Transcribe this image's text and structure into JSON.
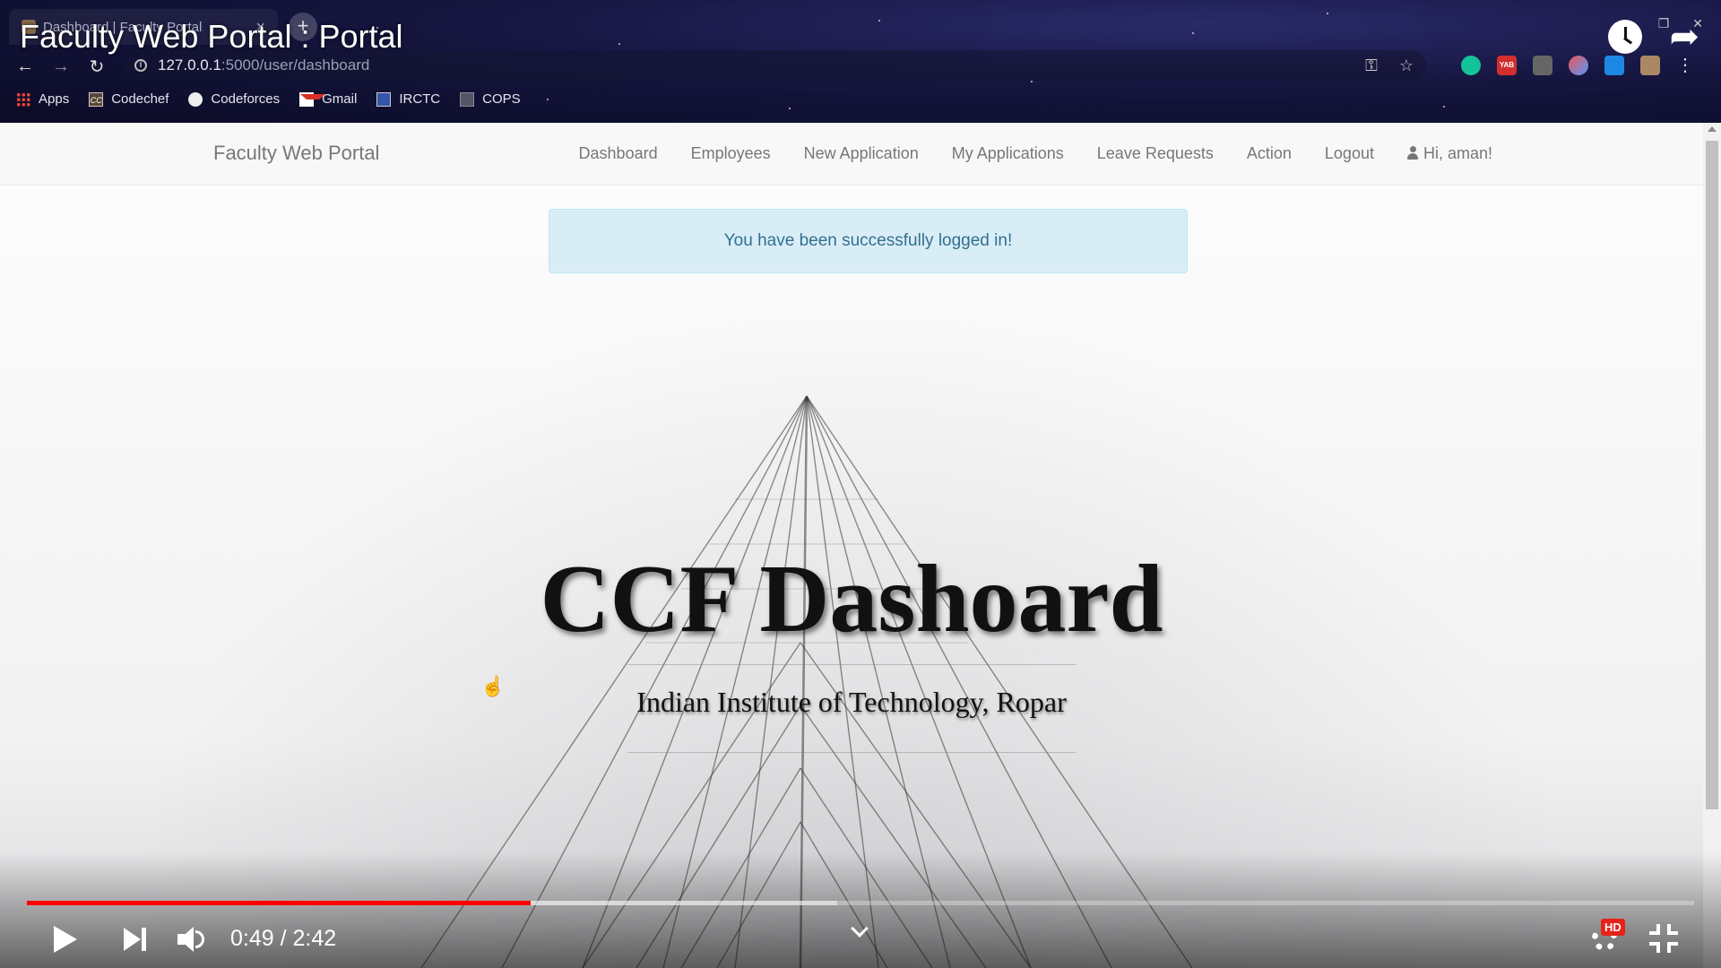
{
  "browser": {
    "tab_title": "Dashboard | Faculty Portal",
    "url_host": "127.0.0.1",
    "url_path": ":5000/user/dashboard",
    "bookmarks": [
      {
        "label": "Apps",
        "icon": "apps-grid-icon"
      },
      {
        "label": "Codechef",
        "icon": "codechef-icon"
      },
      {
        "label": "Codeforces",
        "icon": "codeforces-icon"
      },
      {
        "label": "Gmail",
        "icon": "gmail-icon"
      },
      {
        "label": "IRCTC",
        "icon": "irctc-icon"
      },
      {
        "label": "COPS",
        "icon": "cops-icon"
      }
    ]
  },
  "video": {
    "title": "Faculty Web Portal : Portal",
    "current_time": "0:49",
    "duration": "2:42",
    "time_display": "0:49 / 2:42",
    "played_fraction": 0.302,
    "buffered_fraction": 0.486,
    "quality_badge": "HD",
    "accent_color": "#ff0000"
  },
  "navbar": {
    "brand": "Faculty Web Portal",
    "links": [
      {
        "label": "Dashboard"
      },
      {
        "label": "Employees"
      },
      {
        "label": "New Application"
      },
      {
        "label": "My Applications"
      },
      {
        "label": "Leave Requests"
      },
      {
        "label": "Action"
      },
      {
        "label": "Logout"
      }
    ],
    "greeting": "Hi, aman!"
  },
  "alert": {
    "message": "You have been successfully logged in!",
    "bg_color": "#d9edf7",
    "text_color": "#31708f"
  },
  "hero": {
    "title": "CCF Dashoard",
    "subtitle": "Indian Institute of Technology, Ropar"
  }
}
